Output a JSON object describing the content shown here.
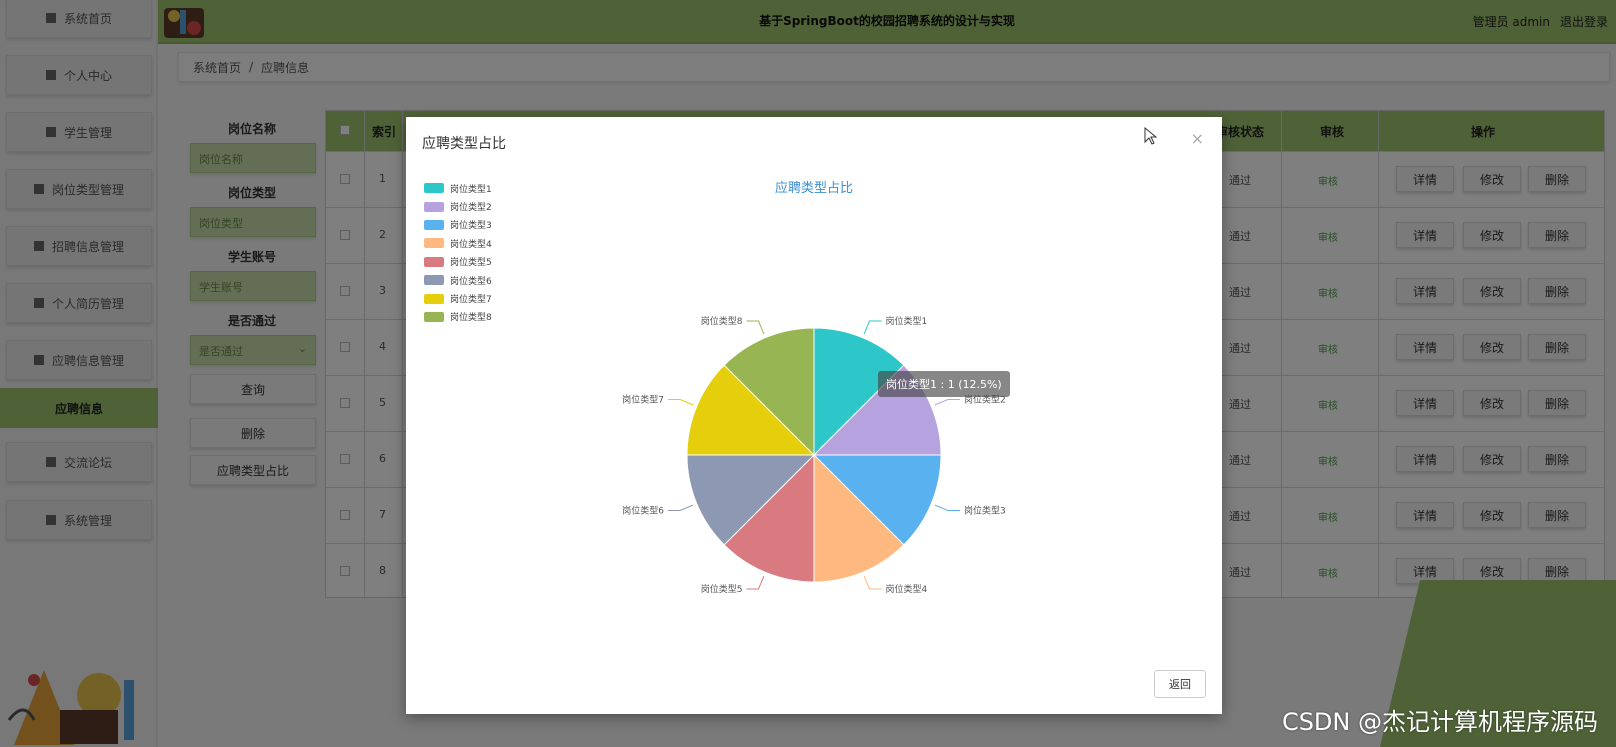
{
  "sidebar": {
    "items": [
      {
        "label": "系统首页",
        "icon": "home-icon"
      },
      {
        "label": "个人中心",
        "icon": "user-icon"
      },
      {
        "label": "学生管理",
        "icon": "student-icon"
      },
      {
        "label": "岗位类型管理",
        "icon": "grid-icon"
      },
      {
        "label": "招聘信息管理",
        "icon": "doc-icon"
      },
      {
        "label": "个人简历管理",
        "icon": "resume-icon"
      },
      {
        "label": "应聘信息管理",
        "icon": "grid-icon"
      },
      {
        "label": "应聘信息",
        "icon": ""
      },
      {
        "label": "交流论坛",
        "icon": "grid-icon"
      },
      {
        "label": "系统管理",
        "icon": "grid-icon"
      }
    ],
    "active_index": 7
  },
  "header": {
    "title": "基于SpringBoot的校园招聘系统的设计与实现",
    "user": "管理员 admin",
    "logout": "退出登录"
  },
  "breadcrumb": {
    "home": "系统首页",
    "separator": "/",
    "current": "应聘信息"
  },
  "filters": {
    "job_name_label": "岗位名称",
    "job_name_placeholder": "岗位名称",
    "job_type_label": "岗位类型",
    "job_type_placeholder": "岗位类型",
    "student_label": "学生账号",
    "student_placeholder": "学生账号",
    "pass_label": "是否通过",
    "pass_placeholder": "是否通过",
    "search_button": "查询",
    "delete_button": "删除",
    "ratio_button": "应聘类型占比"
  },
  "table": {
    "headers": {
      "index": "索引",
      "status": "审核状态",
      "review": "审核",
      "action": "操作"
    },
    "rows": [
      {
        "index": "1",
        "status": "通过",
        "review": "审核"
      },
      {
        "index": "2",
        "status": "通过",
        "review": "审核"
      },
      {
        "index": "3",
        "status": "通过",
        "review": "审核"
      },
      {
        "index": "4",
        "status": "通过",
        "review": "审核"
      },
      {
        "index": "5",
        "status": "通过",
        "review": "审核"
      },
      {
        "index": "6",
        "status": "通过",
        "review": "审核"
      },
      {
        "index": "7",
        "status": "通过",
        "review": "审核"
      },
      {
        "index": "8",
        "status": "通过",
        "review": "审核"
      }
    ],
    "actions": {
      "detail": "详情",
      "edit": "修改",
      "delete": "删除"
    }
  },
  "modal": {
    "title": "应聘类型占比",
    "close": "×",
    "tooltip": "岗位类型1 : 1 (12.5%)",
    "return_button": "返回"
  },
  "chart_data": {
    "type": "pie",
    "title": "应聘类型占比",
    "categories": [
      "岗位类型1",
      "岗位类型2",
      "岗位类型3",
      "岗位类型4",
      "岗位类型5",
      "岗位类型6",
      "岗位类型7",
      "岗位类型8"
    ],
    "values": [
      1,
      1,
      1,
      1,
      1,
      1,
      1,
      1
    ],
    "colors": [
      "#2ec7c9",
      "#b6a2de",
      "#5ab1ef",
      "#ffb980",
      "#d87a80",
      "#8d98b3",
      "#e5cf0d",
      "#97b552"
    ],
    "legend_position": "top-left"
  },
  "watermark": "CSDN @杰记计算机程序源码",
  "theme": {
    "accent": "#9ec46e",
    "link": "#3b8fd1"
  }
}
